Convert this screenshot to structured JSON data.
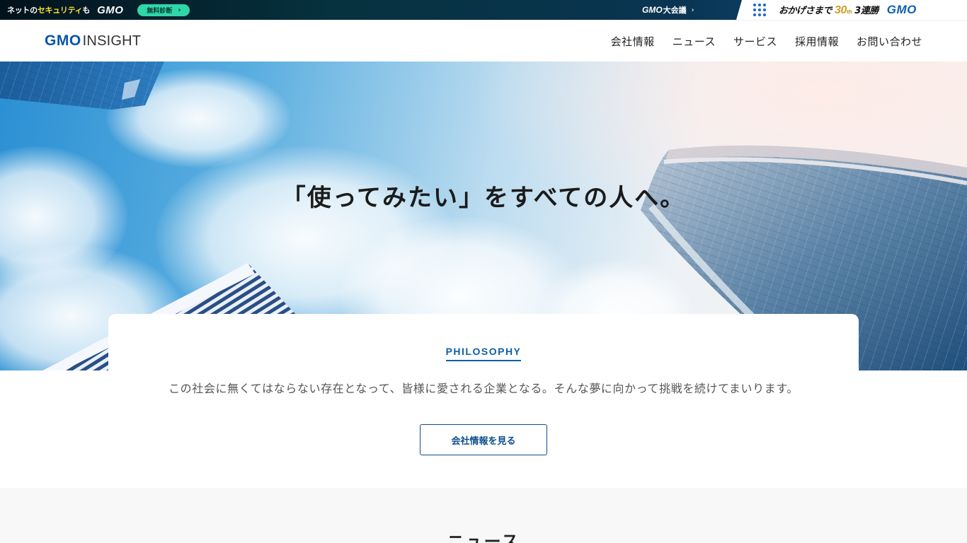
{
  "topbar": {
    "security_prefix": "ネットの",
    "security_highlight": "セキュリティ",
    "security_suffix": "も",
    "gmo_logo": "GMO",
    "diagnosis_button": "無料診断",
    "conference_gmo": "GMO",
    "conference_label": "大会議",
    "thanks_prefix": "おかげさまで",
    "thanks_number": "30",
    "thanks_th": "th",
    "thanks_suffix": "3連勝",
    "gmo_brand": "GMO"
  },
  "header": {
    "logo_gmo": "GMO",
    "logo_insight": "INSIGHT",
    "nav": [
      {
        "label": "会社情報"
      },
      {
        "label": "ニュース"
      },
      {
        "label": "サービス"
      },
      {
        "label": "採用情報"
      },
      {
        "label": "お問い合わせ"
      }
    ]
  },
  "hero": {
    "headline": "「使ってみたい」をすべての人へ。"
  },
  "philosophy": {
    "label": "PHILOSOPHY",
    "text": "この社会に無くてはならない存在となって、皆様に愛される企業となる。そんな夢に向かって挑戦を続けてまいります。",
    "button": "会社情報を見る"
  },
  "news": {
    "title": "ニュース"
  },
  "colors": {
    "brand_blue": "#0a55a8",
    "accent_green": "#2fd6a8",
    "button_border": "#0d4f8c"
  }
}
